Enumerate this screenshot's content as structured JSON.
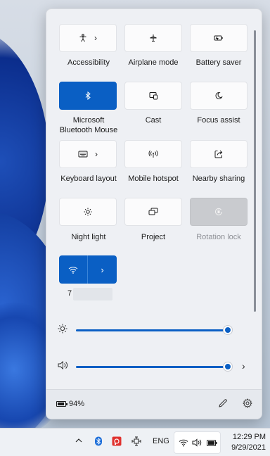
{
  "flyout": {
    "tiles": [
      {
        "label": "Accessibility",
        "icon": "accessibility-icon",
        "chevron": "›"
      },
      {
        "label": "Airplane mode",
        "icon": "airplane-icon"
      },
      {
        "label": "Battery saver",
        "icon": "battery-saver-icon"
      },
      {
        "label": "Microsoft\nBluetooth Mouse",
        "icon": "bluetooth-icon",
        "active": true
      },
      {
        "label": "Cast",
        "icon": "cast-icon"
      },
      {
        "label": "Focus assist",
        "icon": "moon-icon"
      },
      {
        "label": "Keyboard layout",
        "icon": "keyboard-icon",
        "chevron": "›"
      },
      {
        "label": "Mobile hotspot",
        "icon": "hotspot-icon"
      },
      {
        "label": "Nearby sharing",
        "icon": "share-icon"
      },
      {
        "label": "Night light",
        "icon": "brightness-icon"
      },
      {
        "label": "Project",
        "icon": "project-icon"
      },
      {
        "label": "Rotation lock",
        "icon": "rotation-lock-icon",
        "disabled": true
      }
    ],
    "wifi": {
      "name": "7",
      "icon": "wifi-icon",
      "chevron": "›"
    },
    "brightness": {
      "icon": "brightness-icon",
      "level": 1.0
    },
    "volume": {
      "icon": "speaker-icon",
      "level": 1.0,
      "chevron": "›"
    },
    "footer": {
      "battery_percent": "94%",
      "edit_icon": "pencil-icon",
      "settings_icon": "gear-icon"
    }
  },
  "taskbar": {
    "language": "ENG",
    "time": "12:29 PM",
    "date": "9/29/2021"
  },
  "colors": {
    "accent": "#0a5fc4",
    "panel_bg": "#eef0f4",
    "disabled_tile": "#c9cbcf"
  }
}
